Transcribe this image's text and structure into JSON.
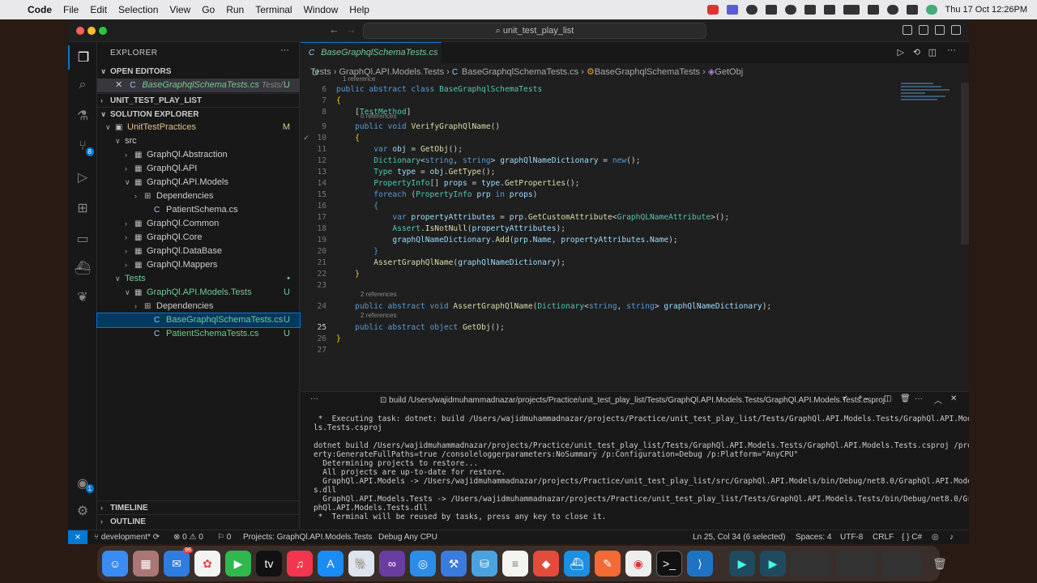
{
  "menubar": {
    "app": "Code",
    "items": [
      "File",
      "Edit",
      "Selection",
      "View",
      "Go",
      "Run",
      "Terminal",
      "Window",
      "Help"
    ],
    "clock": "Thu 17 Oct  12:26PM"
  },
  "window": {
    "command_center": "unit_test_play_list"
  },
  "explorer": {
    "title": "EXPLORER",
    "open_editors": "OPEN EDITORS",
    "open_file": "BaseGraphqlSchemaTests.cs",
    "open_file_path": "Tests/...",
    "open_file_badge": "U",
    "workspace": "UNIT_TEST_PLAY_LIST",
    "solution": "SOLUTION EXPLORER",
    "timeline": "TIMELINE",
    "outline": "OUTLINE",
    "tree": [
      {
        "label": "UnitTestPractices",
        "badge": "M",
        "indent": 1,
        "chev": "∨",
        "icon": "▣"
      },
      {
        "label": "src",
        "badge": "",
        "indent": 2,
        "chev": "∨",
        "icon": ""
      },
      {
        "label": "GraphQl.Abstraction",
        "badge": "",
        "indent": 3,
        "chev": "›",
        "icon": "▦"
      },
      {
        "label": "GraphQl.API",
        "badge": "",
        "indent": 3,
        "chev": "›",
        "icon": "▦"
      },
      {
        "label": "GraphQl.API.Models",
        "badge": "",
        "indent": 3,
        "chev": "∨",
        "icon": "▦"
      },
      {
        "label": "Dependencies",
        "badge": "",
        "indent": 4,
        "chev": "›",
        "icon": "⊞"
      },
      {
        "label": "PatientSchema.cs",
        "badge": "",
        "indent": 5,
        "chev": "",
        "icon": "C"
      },
      {
        "label": "GraphQl.Common",
        "badge": "",
        "indent": 3,
        "chev": "›",
        "icon": "▦"
      },
      {
        "label": "GraphQl.Core",
        "badge": "",
        "indent": 3,
        "chev": "›",
        "icon": "▦"
      },
      {
        "label": "GraphQl.DataBase",
        "badge": "",
        "indent": 3,
        "chev": "›",
        "icon": "▦"
      },
      {
        "label": "GraphQl.Mappers",
        "badge": "",
        "indent": 3,
        "chev": "›",
        "icon": "▦"
      },
      {
        "label": "Tests",
        "badge": "•",
        "indent": 2,
        "chev": "∨",
        "icon": ""
      },
      {
        "label": "GraphQl.API.Models.Tests",
        "badge": "U",
        "indent": 3,
        "chev": "∨",
        "icon": "▦"
      },
      {
        "label": "Dependencies",
        "badge": "",
        "indent": 4,
        "chev": "›",
        "icon": "⊞"
      },
      {
        "label": "BaseGraphqlSchemaTests.cs",
        "badge": "U",
        "indent": 5,
        "chev": "",
        "icon": "C"
      },
      {
        "label": "PatientSchemaTests.cs",
        "badge": "U",
        "indent": 5,
        "chev": "",
        "icon": "C"
      }
    ]
  },
  "editor": {
    "tab": "BaseGraphqlSchemaTests.cs",
    "tab_badge": "U",
    "breadcrumbs": [
      "Tests",
      "GraphQl.API.Models.Tests",
      "BaseGraphqlSchemaTests.cs",
      "BaseGraphqlSchemaTests",
      "GetObj"
    ],
    "lines": [
      {
        "n": "6",
        "html": "<span class='kw'>public abstract class</span> <span class='ty'>BaseGraphqlSchemaTests</span>"
      },
      {
        "n": "7",
        "html": "<span class='br'>{</span>"
      },
      {
        "n": "8",
        "html": "    [<span class='at'>TestMethod</span>]"
      },
      {
        "n": "9",
        "html": "    <span class='kw'>public void</span> <span class='fn'>VerifyGraphQlName</span>()"
      },
      {
        "n": "10",
        "html": "    <span class='br'>{</span>"
      },
      {
        "n": "11",
        "html": "        <span class='kw'>var</span> <span class='vr'>obj</span> = <span class='fn'>GetObj</span>();"
      },
      {
        "n": "12",
        "html": "        <span class='ty'>Dictionary</span>&lt;<span class='kw'>string</span>, <span class='kw'>string</span>&gt; <span class='vr'>graphQlNameDictionary</span> = <span class='kw'>new</span>();"
      },
      {
        "n": "13",
        "html": "        <span class='ty'>Type</span> <span class='vr'>type</span> = <span class='vr'>obj</span>.<span class='fn'>GetType</span>();"
      },
      {
        "n": "14",
        "html": "        <span class='ty'>PropertyInfo</span>[] <span class='vr'>props</span> = <span class='vr'>type</span>.<span class='fn'>GetProperties</span>();"
      },
      {
        "n": "15",
        "html": "        <span class='kw'>foreach</span> (<span class='ty'>PropertyInfo</span> <span class='vr'>prp</span> <span class='kw'>in</span> <span class='vr'>props</span>)"
      },
      {
        "n": "16",
        "html": "        <span class='kw'>{</span>"
      },
      {
        "n": "17",
        "html": "            <span class='kw'>var</span> <span class='vr'>propertyAttributes</span> = <span class='vr'>prp</span>.<span class='fn'>GetCustomAttribute</span>&lt;<span class='ty'>GraphQLNameAttribute</span>&gt;();"
      },
      {
        "n": "18",
        "html": "            <span class='ty'>Assert</span>.<span class='fn'>IsNotNull</span>(<span class='vr'>propertyAttributes</span>);"
      },
      {
        "n": "19",
        "html": "            <span class='vr'>graphQlNameDictionary</span>.<span class='fn'>Add</span>(<span class='vr'>prp</span>.<span class='vr'>Name</span>, <span class='vr'>propertyAttributes</span>.<span class='vr'>Name</span>);"
      },
      {
        "n": "20",
        "html": "        <span class='kw'>}</span>"
      },
      {
        "n": "21",
        "html": "        <span class='fn'>AssertGraphQlName</span>(<span class='vr'>graphQlNameDictionary</span>);"
      },
      {
        "n": "22",
        "html": "    <span class='br'>}</span>"
      },
      {
        "n": "23",
        "html": ""
      },
      {
        "n": "24",
        "html": "    <span class='kw'>public abstract void</span> <span class='fn'>AssertGraphQlName</span>(<span class='ty'>Dictionary</span>&lt;<span class='kw'>string</span>, <span class='kw'>string</span>&gt; <span class='vr'>graphQlNameDictionary</span>);"
      },
      {
        "n": "25",
        "html": "    <span class='kw'>public abstract object</span> <span class='fn'>GetObj</span>();"
      },
      {
        "n": "26",
        "html": "<span class='br'>}</span>"
      },
      {
        "n": "27",
        "html": ""
      }
    ],
    "refs": [
      "1 reference",
      "0 references",
      "2 references",
      "2 references"
    ]
  },
  "terminal": {
    "title": "build /Users/wajidmuhammadnazar/projects/Practice/unit_test_play_list/Tests/GraphQl.API.Models.Tests/GraphQl.API.Models.Tests.csproj",
    "text": " *  Executing task: dotnet: build /Users/wajidmuhammadnazar/projects/Practice/unit_test_play_list/Tests/GraphQl.API.Models.Tests/GraphQl.API.Models\nls.Tests.csproj\n\ndotnet build /Users/wajidmuhammadnazar/projects/Practice/unit_test_play_list/Tests/GraphQl.API.Models.Tests/GraphQl.API.Models.Tests.csproj /prop\nerty:GenerateFullPaths=true /consoleloggerparameters:NoSummary /p:Configuration=Debug /p:Platform=\"AnyCPU\"\n  Determining projects to restore...\n  All projects are up-to-date for restore.\n  GraphQl.API.Models -> /Users/wajidmuhammadnazar/projects/Practice/unit_test_play_list/src/GraphQl.API.Models/bin/Debug/net8.0/GraphQl.API.Model\ns.dll\n  GraphQl.API.Models.Tests -> /Users/wajidmuhammadnazar/projects/Practice/unit_test_play_list/Tests/GraphQl.API.Models.Tests/bin/Debug/net8.0/Gra\nphQl.API.Models.Tests.dll\n *  Terminal will be reused by tasks, press any key to close it."
  },
  "status": {
    "branch": "development*",
    "problems": "⊗ 0 ⚠ 0",
    "ports": "⚐ 0",
    "project": "Projects: GraphQl.API.Models.Tests",
    "debug": "Debug Any CPU",
    "position": "Ln 25, Col 34 (6 selected)",
    "spaces": "Spaces: 4",
    "encoding": "UTF-8",
    "eol": "CRLF",
    "lang": "{ } C#"
  },
  "dock": {
    "mail_badge": "96"
  }
}
